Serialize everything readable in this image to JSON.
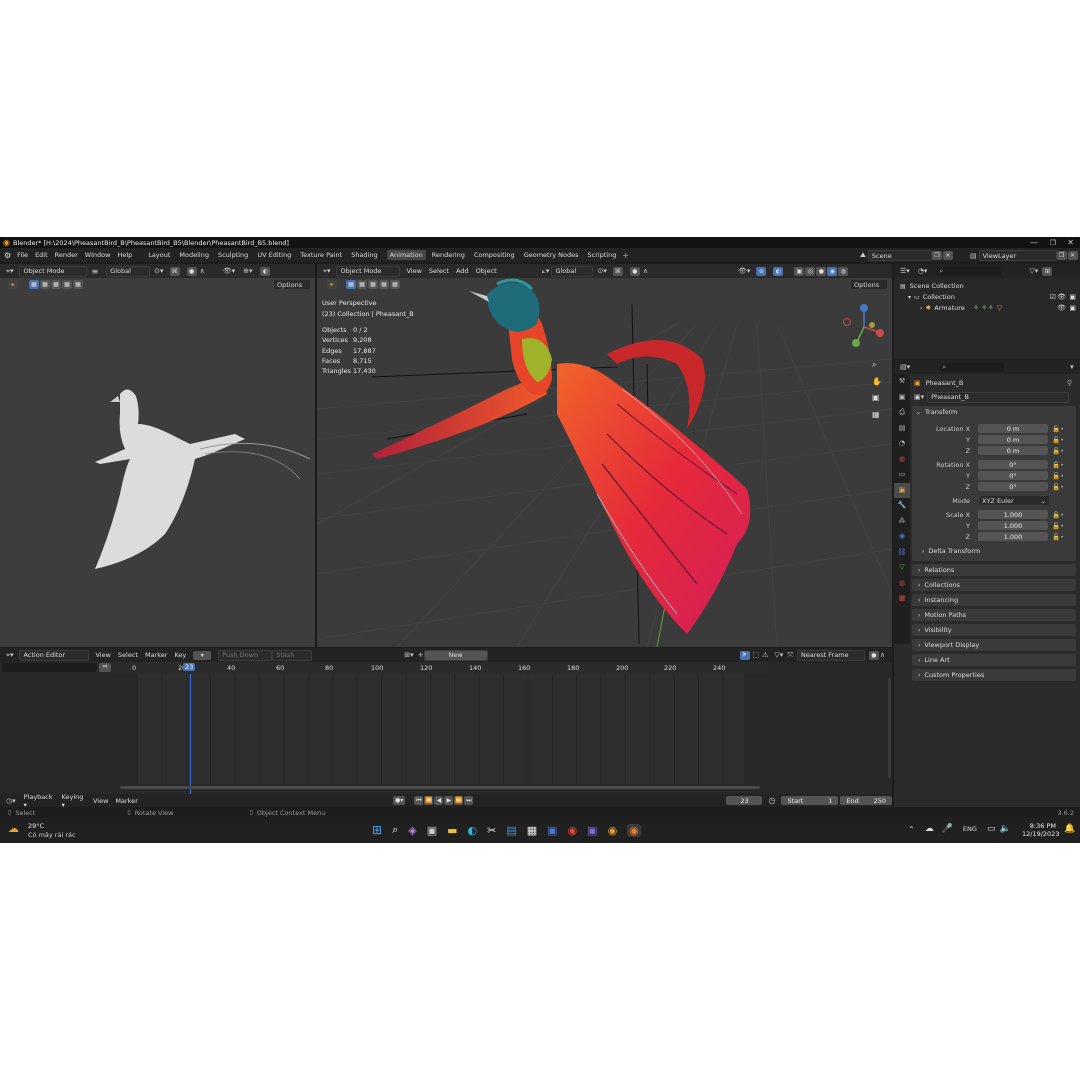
{
  "titlebar": {
    "title": "Blender* [H:\\2024\\PheasantBird_B\\PheasantBird_B5\\Blender\\PheasantBird_B5.blend]"
  },
  "menus": [
    "File",
    "Edit",
    "Render",
    "Window",
    "Help"
  ],
  "workspaces": [
    "Layout",
    "Modeling",
    "Sculpting",
    "UV Editing",
    "Texture Paint",
    "Shading",
    "Animation",
    "Rendering",
    "Compositing",
    "Geometry Nodes",
    "Scripting"
  ],
  "active_workspace": "Animation",
  "scene": {
    "label": "Scene",
    "view_layer": "ViewLayer"
  },
  "left_viewport": {
    "mode": "Object Mode",
    "orientation": "Global",
    "options": "Options"
  },
  "main_viewport": {
    "mode": "Object Mode",
    "menus": [
      "View",
      "Select",
      "Add",
      "Object"
    ],
    "orientation": "Global",
    "options": "Options",
    "perspective": "User Perspective",
    "collection_line": "(23) Collection | Pheasant_B",
    "stats": [
      {
        "label": "Objects",
        "value": "0 / 2"
      },
      {
        "label": "Vertices",
        "value": "9,208"
      },
      {
        "label": "Edges",
        "value": "17,887"
      },
      {
        "label": "Faces",
        "value": "8,715"
      },
      {
        "label": "Triangles",
        "value": "17,430"
      }
    ]
  },
  "action_editor": {
    "mode": "Action Editor",
    "menus": [
      "View",
      "Select",
      "Marker",
      "Key"
    ],
    "push_down": "Push Down",
    "stash": "Stash",
    "new_button": "New",
    "snap": "Nearest Frame",
    "ruler": [
      "0",
      "20",
      "40",
      "60",
      "80",
      "100",
      "120",
      "140",
      "160",
      "180",
      "200",
      "220",
      "240"
    ],
    "current_frame": "23"
  },
  "timeline": {
    "menus": [
      "Playback",
      "Keying",
      "View",
      "Marker"
    ],
    "frame": "23",
    "start_label": "Start",
    "start": "1",
    "end_label": "End",
    "end": "250"
  },
  "statusbar": {
    "select": "Select",
    "rotate": "Rotate View",
    "context": "Object Context Menu",
    "version": "3.6.2"
  },
  "outliner": {
    "scene_collection": "Scene Collection",
    "collection": "Collection",
    "armature": "Armature"
  },
  "properties": {
    "object_name": "Pheasant_B",
    "data_name": "Pheasant_B",
    "transform": "Transform",
    "location_label": "Location X",
    "location": [
      "0 m",
      "0 m",
      "0 m"
    ],
    "rotation_label": "Rotation X",
    "rotation": [
      "0°",
      "0°",
      "0°"
    ],
    "mode_label": "Mode",
    "mode_value": "XYZ Euler",
    "scale_label": "Scale X",
    "scale": [
      "1.000",
      "1.000",
      "1.000"
    ],
    "axis_y": "Y",
    "axis_z": "Z",
    "delta": "Delta Transform",
    "panels": [
      "Relations",
      "Collections",
      "Instancing",
      "Motion Paths",
      "Visibility",
      "Viewport Display",
      "Line Art",
      "Custom Properties"
    ]
  },
  "taskbar": {
    "temp": "29°C",
    "weather": "Có mây rải rác",
    "lang": "ENG",
    "time": "8:36 PM",
    "date": "12/19/2023"
  },
  "colors": {
    "accent": "#4772b3",
    "keyframe_line": "#3f6fd6",
    "panel": "#303030",
    "header": "#232323"
  }
}
